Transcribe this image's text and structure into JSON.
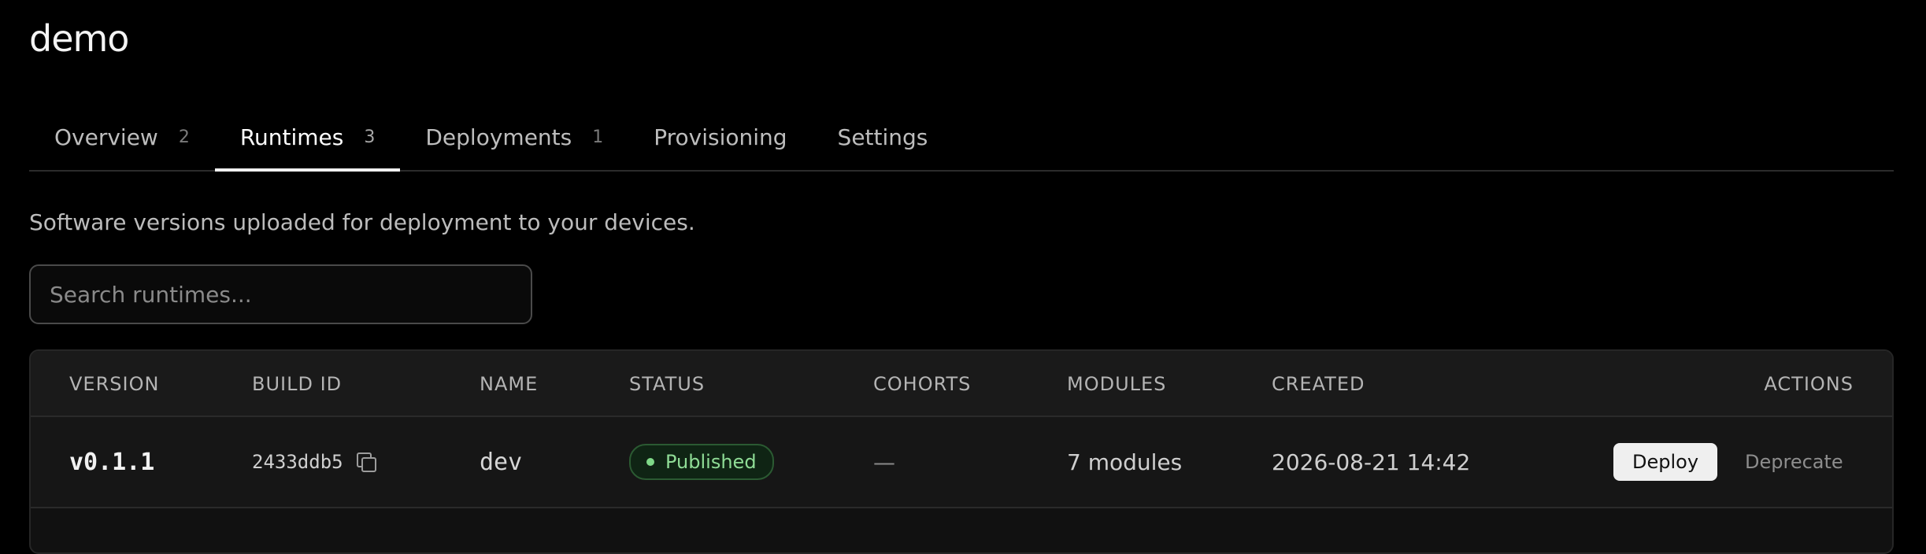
{
  "page": {
    "title": "demo"
  },
  "tabs": [
    {
      "label": "Overview",
      "count": "2"
    },
    {
      "label": "Runtimes",
      "count": "3",
      "active": true
    },
    {
      "label": "Deployments",
      "count": "1"
    },
    {
      "label": "Provisioning",
      "count": ""
    },
    {
      "label": "Settings",
      "count": ""
    }
  ],
  "description": "Software versions uploaded for deployment to your devices.",
  "search": {
    "placeholder": "Search runtimes...",
    "value": ""
  },
  "table": {
    "headers": {
      "version": "VERSION",
      "build_id": "BUILD ID",
      "name": "NAME",
      "status": "STATUS",
      "cohorts": "COHORTS",
      "modules": "MODULES",
      "created": "CREATED",
      "actions": "ACTIONS"
    },
    "rows": [
      {
        "version": "v0.1.1",
        "build_id": "2433ddb5",
        "name": "dev",
        "status": "Published",
        "cohorts": "—",
        "modules": "7 modules",
        "created": "2026-08-21 14:42",
        "deploy_label": "Deploy",
        "deprecate_label": "Deprecate"
      }
    ]
  },
  "icons": {
    "copy": "copy-icon",
    "status_dot": "status-dot-icon"
  },
  "colors": {
    "background": "#000000",
    "accent": "#f0f0f0",
    "published": "#8fdc96"
  }
}
